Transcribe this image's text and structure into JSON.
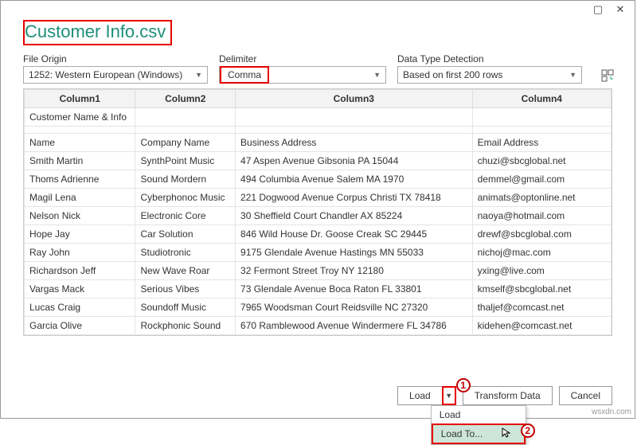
{
  "window": {
    "title": "Customer Info.csv"
  },
  "controls": {
    "fileOrigin": {
      "label": "File Origin",
      "value": "1252: Western European (Windows)"
    },
    "delimiter": {
      "label": "Delimiter",
      "value": "Comma"
    },
    "detection": {
      "label": "Data Type Detection",
      "value": "Based on first 200 rows"
    }
  },
  "headers": [
    "Column1",
    "Column2",
    "Column3",
    "Column4"
  ],
  "rows": [
    [
      "Customer Name & Info",
      "",
      "",
      ""
    ],
    [
      "",
      "",
      "",
      ""
    ],
    [
      "Name",
      "Company Name",
      "Business Address",
      "Email Address"
    ],
    [
      "Smith Martin",
      "SynthPoint Music",
      "47 Aspen Avenue Gibsonia PA 15044",
      "chuzi@sbcglobal.net"
    ],
    [
      "Thoms Adrienne",
      "Sound Mordern",
      "494 Columbia Avenue Salem MA 1970",
      "demmel@gmail.com"
    ],
    [
      "Magil Lena",
      "Cyberphonoc Music",
      "221 Dogwood Avenue Corpus Christi TX 78418",
      "animats@optonline.net"
    ],
    [
      "Nelson Nick",
      "Electronic Core",
      "30 Sheffield Court Chandler AX 85224",
      "naoya@hotmail.com"
    ],
    [
      "Hope Jay",
      "Car Solution",
      "846 Wild House Dr. Goose Creak SC 29445",
      "drewf@sbcglobal.com"
    ],
    [
      "Ray John",
      "Studiotronic",
      "9175 Glendale Avenue Hastings MN 55033",
      "nichoj@mac.com"
    ],
    [
      "Richardson Jeff",
      "New Wave Roar",
      "32 Fermont Street Troy NY 12180",
      "yxing@live.com"
    ],
    [
      "Vargas Mack",
      "Serious Vibes",
      "73 Glendale Avenue Boca Raton FL 33801",
      "kmself@sbcglobal.net"
    ],
    [
      "Lucas Craig",
      "Soundoff Music",
      "7965 Woodsman Court Reidsville NC 27320",
      "thaljef@comcast.net"
    ],
    [
      "Garcia Olive",
      "Rockphonic Sound",
      "670 Ramblewood Avenue Windermere FL 34786",
      "kidehen@comcast.net"
    ]
  ],
  "footer": {
    "load": "Load",
    "transform": "Transform Data",
    "cancel": "Cancel"
  },
  "menu": {
    "load": "Load",
    "loadTo": "Load To..."
  },
  "badges": {
    "one": "1",
    "two": "2"
  },
  "watermark": "wsxdn.com"
}
